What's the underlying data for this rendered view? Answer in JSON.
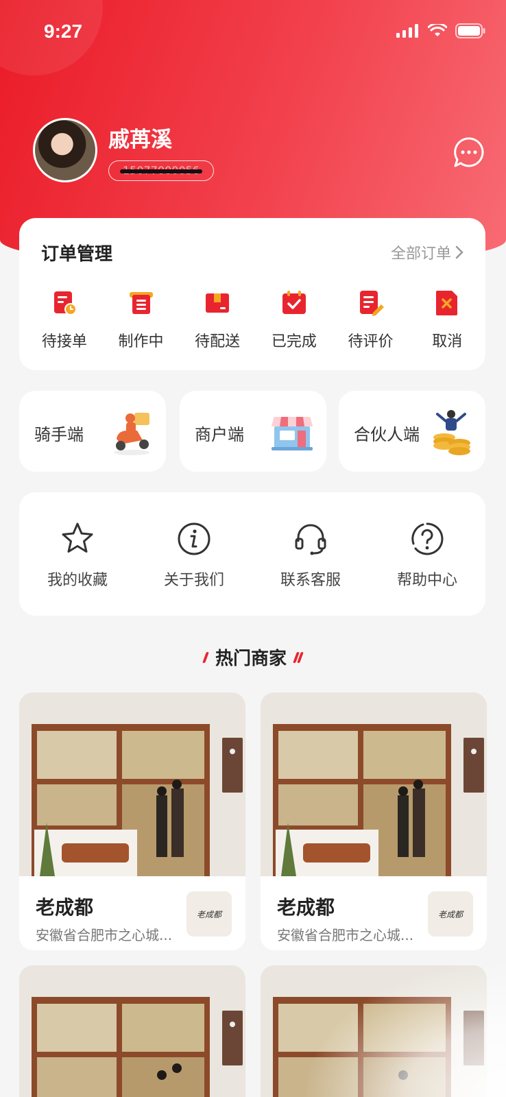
{
  "status_bar": {
    "time": "9:27"
  },
  "profile": {
    "name": "戚苒溪",
    "phone": "15077000056"
  },
  "orders": {
    "title": "订单管理",
    "all_label": "全部订单",
    "items": [
      {
        "label": "待接单",
        "icon": "pending-order-icon"
      },
      {
        "label": "制作中",
        "icon": "in-production-icon"
      },
      {
        "label": "待配送",
        "icon": "awaiting-delivery-icon"
      },
      {
        "label": "已完成",
        "icon": "completed-icon"
      },
      {
        "label": "待评价",
        "icon": "to-review-icon"
      },
      {
        "label": "取消",
        "icon": "cancel-icon"
      }
    ]
  },
  "portals": [
    {
      "label": "骑手端",
      "icon": "rider-scooter-icon"
    },
    {
      "label": "商户端",
      "icon": "storefront-icon"
    },
    {
      "label": "合伙人端",
      "icon": "partner-coins-icon"
    }
  ],
  "services": [
    {
      "label": "我的收藏",
      "icon": "star-icon"
    },
    {
      "label": "关于我们",
      "icon": "info-icon"
    },
    {
      "label": "联系客服",
      "icon": "headset-icon"
    },
    {
      "label": "帮助中心",
      "icon": "help-icon"
    }
  ],
  "hot_shops": {
    "title": "热门商家",
    "items": [
      {
        "name": "老成都",
        "address": "安徽省合肥市之心城...",
        "logo_text": "老成都"
      },
      {
        "name": "老成都",
        "address": "安徽省合肥市之心城...",
        "logo_text": "老成都"
      },
      {
        "name": "",
        "address": "",
        "logo_text": ""
      },
      {
        "name": "",
        "address": "",
        "logo_text": ""
      }
    ]
  },
  "colors": {
    "brand": "#ea1b27",
    "icon_red": "#e8252f",
    "icon_orange": "#f5a623"
  }
}
